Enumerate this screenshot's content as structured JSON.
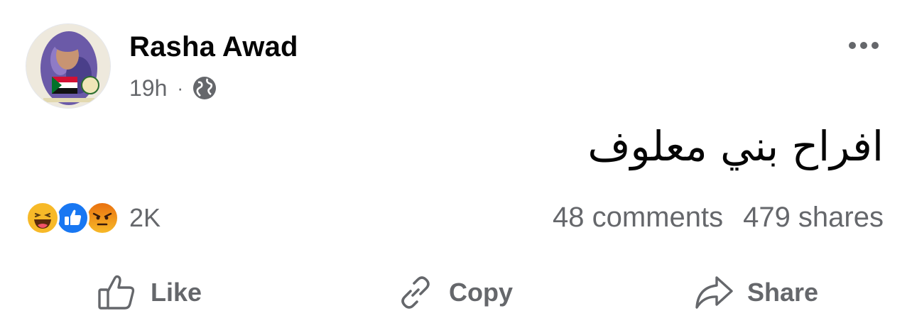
{
  "post": {
    "author": "Rasha Awad",
    "time": "19h",
    "separator": "·",
    "privacy_icon": "globe-icon",
    "text": "افراح بني معلوف"
  },
  "reactions": {
    "icons": [
      "haha-icon",
      "like-icon",
      "angry-icon"
    ],
    "count": "2K"
  },
  "stats": {
    "comments": "48 comments",
    "shares": "479 shares"
  },
  "actions": {
    "like": "Like",
    "copy": "Copy",
    "share": "Share"
  },
  "colors": {
    "text_primary": "#050505",
    "text_secondary": "#65676b",
    "like_blue": "#1877f2",
    "haha_yellow": "#f7b928",
    "angry_orange": "#e9710f"
  }
}
